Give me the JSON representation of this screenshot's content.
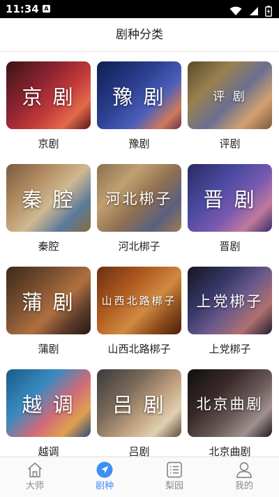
{
  "status_bar": {
    "time": "11:34",
    "a_badge": "A"
  },
  "header": {
    "title": "剧种分类"
  },
  "genres": [
    {
      "tile_text": "京 剧",
      "label": "京剧",
      "bg": "linear-gradient(135deg,#3b1414 0%,#8a2230 35%,#c23a3a 60%,#e26a4a 80%,#5a1616 100%)",
      "font": 29
    },
    {
      "tile_text": "豫 剧",
      "label": "豫剧",
      "bg": "linear-gradient(135deg,#0e1e52 0%,#2b3f8f 40%,#4b5fbb 65%,#d07a5a 85%,#6a3050 100%)",
      "font": 29
    },
    {
      "tile_text": "评 剧",
      "label": "评剧",
      "bg": "linear-gradient(135deg,#5a4a2a 0%,#9a8050 30%,#6a7090 55%,#d4a070 78%,#7a5a3a 100%)",
      "font": 17
    },
    {
      "tile_text": "秦 腔",
      "label": "秦腔",
      "bg": "linear-gradient(135deg,#7a5a40 0%,#b08a60 30%,#d0b890 55%,#5a7a9a 78%,#8a6a40 100%)",
      "font": 29
    },
    {
      "tile_text": "河北梆子",
      "label": "河北梆子",
      "bg": "linear-gradient(135deg,#8a7050 0%,#c0a070 30%,#907050 55%,#5a6080 78%,#a07a50 100%)",
      "font": 21
    },
    {
      "tile_text": "晋 剧",
      "label": "晋剧",
      "bg": "linear-gradient(135deg,#2a2a60 0%,#4a4aa0 35%,#7a5ab0 60%,#c07a9a 80%,#3a2a6a 100%)",
      "font": 29
    },
    {
      "tile_text": "蒲 剧",
      "label": "蒲剧",
      "bg": "linear-gradient(135deg,#3a2a1a 0%,#7a5030 35%,#b07040 60%,#5a3a2a 80%,#2a1a10 100%)",
      "font": 29
    },
    {
      "tile_text": "山西北路梆子",
      "label": "山西北路梆子",
      "bg": "linear-gradient(135deg,#6a3010 0%,#b05a20 35%,#d08a40 60%,#8a4a1a 80%,#4a2010 100%)",
      "font": 15
    },
    {
      "tile_text": "上党梆子",
      "label": "上党梆子",
      "bg": "linear-gradient(135deg,#141424 0%,#3a3a6a 35%,#6a5a8a 55%,#b07070 78%,#202030 100%)",
      "font": 21
    },
    {
      "tile_text": "越 调",
      "label": "越调",
      "bg": "linear-gradient(135deg,#1a5a8a 0%,#3a8ac0 35%,#d06a7a 60%,#e0a050 80%,#2a4a7a 100%)",
      "font": 29
    },
    {
      "tile_text": "吕 剧",
      "label": "吕剧",
      "bg": "linear-gradient(135deg,#3a3a3a 0%,#7a6a5a 35%,#c0a080 60%,#e0d0b0 80%,#5a4a3a 100%)",
      "font": 29
    },
    {
      "tile_text": "北京曲剧",
      "label": "北京曲剧",
      "bg": "linear-gradient(135deg,#101010 0%,#3a2a2a 35%,#6a5a5a 60%,#a09090 80%,#201818 100%)",
      "font": 21
    }
  ],
  "tabs": [
    {
      "label": "大师",
      "icon": "home-icon",
      "active": false
    },
    {
      "label": "剧种",
      "icon": "compass-icon",
      "active": true
    },
    {
      "label": "梨园",
      "icon": "list-icon",
      "active": false
    },
    {
      "label": "我的",
      "icon": "user-icon",
      "active": false
    }
  ],
  "colors": {
    "accent": "#3e8ff5",
    "inactive": "#8a8a8a",
    "status_bar": "#000000"
  }
}
